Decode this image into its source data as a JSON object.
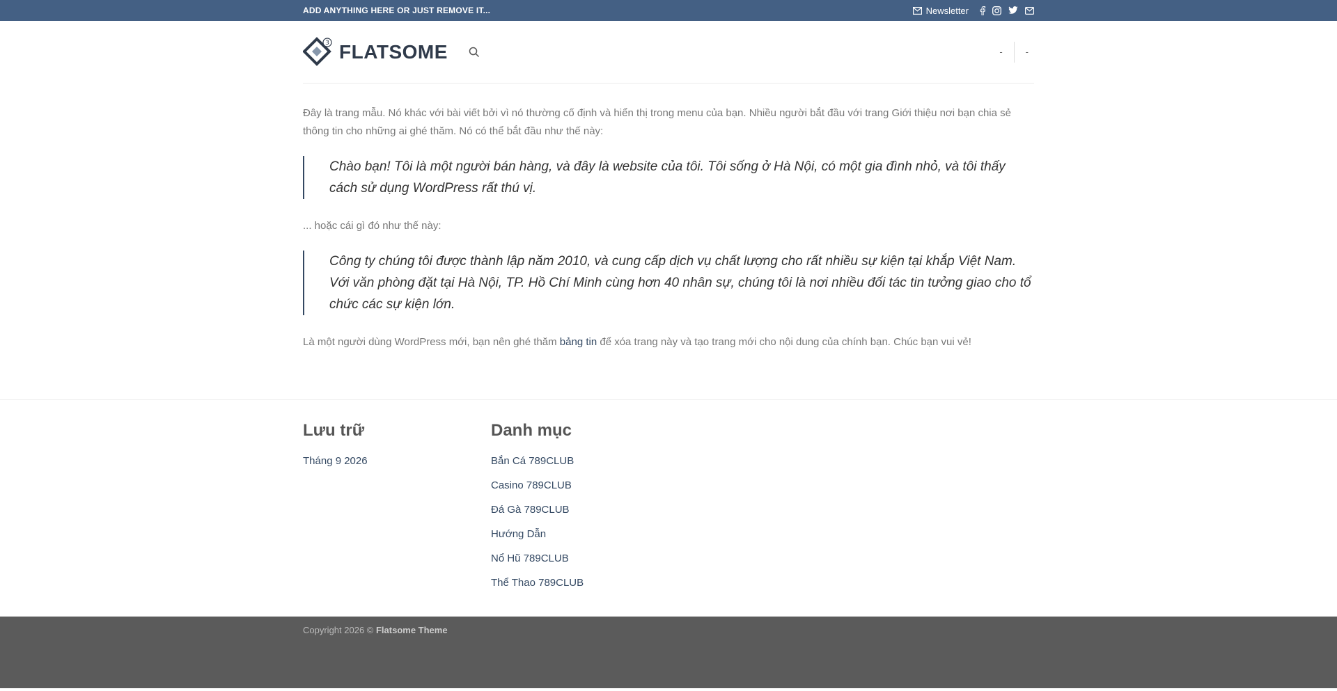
{
  "topbar": {
    "text": "ADD ANYTHING HERE OR JUST REMOVE IT...",
    "newsletter_label": "Newsletter",
    "social_icons": [
      "facebook-icon",
      "instagram-icon",
      "twitter-icon",
      "email-icon"
    ]
  },
  "header": {
    "logo_text": "FLATSOME",
    "logo_badge": "3",
    "nav_right": [
      "-",
      "-"
    ]
  },
  "content": {
    "paragraph1": "Đây là trang mẫu. Nó khác với bài viết bởi vì nó thường cố định và hiển thị trong menu của bạn. Nhiều người bắt đầu với trang Giới thiệu nơi bạn chia sẻ thông tin cho những ai ghé thăm. Nó có thể bắt đầu như thế này:",
    "quote1": "Chào bạn! Tôi là một người bán hàng, và đây là website của tôi. Tôi sống ở Hà Nội, có một gia đình nhỏ, và tôi thấy cách sử dụng WordPress rất thú vị.",
    "paragraph2": "... hoặc cái gì đó như thế này:",
    "quote2": "Công ty chúng tôi được thành lập năm 2010, và cung cấp dịch vụ chất lượng cho rất nhiều sự kiện tại khắp Việt Nam. Với văn phòng đặt tại Hà Nội, TP. Hồ Chí Minh cùng hơn 40 nhân sự, chúng tôi là nơi nhiều đối tác tin tưởng giao cho tổ chức các sự kiện lớn.",
    "paragraph3_before": "Là một người dùng WordPress mới, bạn nên ghé thăm ",
    "paragraph3_link": "bảng tin",
    "paragraph3_after": " để xóa trang này và tạo trang mới cho nội dung của chính bạn. Chúc bạn vui vẻ!"
  },
  "footer": {
    "archive_title": "Lưu trữ",
    "archive_items": [
      "Tháng 9 2026"
    ],
    "category_title": "Danh mục",
    "category_items": [
      "Bắn Cá 789CLUB",
      "Casino 789CLUB",
      "Đá Gà 789CLUB",
      "Hướng Dẫn",
      "Nổ Hũ 789CLUB",
      "Thể Thao 789CLUB"
    ],
    "copyright_prefix": "Copyright 2026 © ",
    "copyright_brand": "Flatsome Theme"
  },
  "colors": {
    "topbar_bg": "#446084",
    "link": "#334862",
    "footer_bg": "#5b5b5b"
  }
}
